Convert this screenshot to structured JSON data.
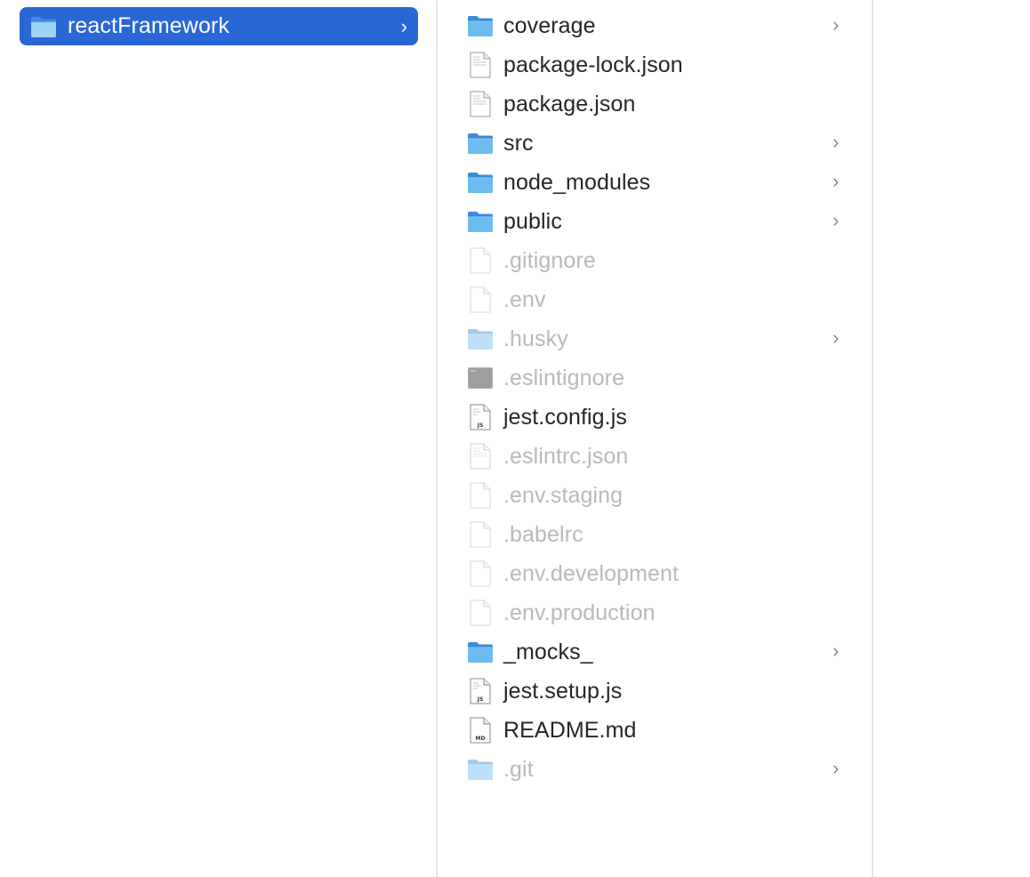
{
  "colors": {
    "selection": "#2966d6",
    "folder": "#5aaeea",
    "text": "#262626",
    "hidden_text": "#b9b9b9",
    "chevron": "#8a8a8a"
  },
  "column1": {
    "selected_folder": {
      "name": "reactFramework",
      "icon": "folder-icon",
      "chevron": "›"
    }
  },
  "column2": {
    "items": [
      {
        "name": "coverage",
        "kind": "folder",
        "icon": "folder-icon",
        "hidden": false,
        "chevron": "›"
      },
      {
        "name": "package-lock.json",
        "kind": "file",
        "icon": "document-icon",
        "hidden": false,
        "chevron": ""
      },
      {
        "name": "package.json",
        "kind": "file",
        "icon": "document-icon",
        "hidden": false,
        "chevron": ""
      },
      {
        "name": "src",
        "kind": "folder",
        "icon": "folder-icon",
        "hidden": false,
        "chevron": "›"
      },
      {
        "name": "node_modules",
        "kind": "folder",
        "icon": "folder-icon",
        "hidden": false,
        "chevron": "›"
      },
      {
        "name": "public",
        "kind": "folder",
        "icon": "folder-icon",
        "hidden": false,
        "chevron": "›"
      },
      {
        "name": ".gitignore",
        "kind": "file",
        "icon": "blank-file-icon",
        "hidden": true,
        "chevron": ""
      },
      {
        "name": ".env",
        "kind": "file",
        "icon": "blank-file-icon",
        "hidden": true,
        "chevron": ""
      },
      {
        "name": ".husky",
        "kind": "folder",
        "icon": "folder-icon",
        "hidden": true,
        "chevron": "›"
      },
      {
        "name": ".eslintignore",
        "kind": "file",
        "icon": "exec-file-icon",
        "hidden": true,
        "chevron": ""
      },
      {
        "name": "jest.config.js",
        "kind": "file",
        "icon": "js-file-icon",
        "hidden": false,
        "chevron": "",
        "badge": "JS"
      },
      {
        "name": ".eslintrc.json",
        "kind": "file",
        "icon": "document-icon",
        "hidden": true,
        "chevron": ""
      },
      {
        "name": ".env.staging",
        "kind": "file",
        "icon": "blank-file-icon",
        "hidden": true,
        "chevron": ""
      },
      {
        "name": ".babelrc",
        "kind": "file",
        "icon": "blank-file-icon",
        "hidden": true,
        "chevron": ""
      },
      {
        "name": ".env.development",
        "kind": "file",
        "icon": "blank-file-icon",
        "hidden": true,
        "chevron": ""
      },
      {
        "name": ".env.production",
        "kind": "file",
        "icon": "blank-file-icon",
        "hidden": true,
        "chevron": ""
      },
      {
        "name": "_mocks_",
        "kind": "folder",
        "icon": "folder-icon",
        "hidden": false,
        "chevron": "›"
      },
      {
        "name": "jest.setup.js",
        "kind": "file",
        "icon": "js-file-icon",
        "hidden": false,
        "chevron": "",
        "badge": "JS"
      },
      {
        "name": "README.md",
        "kind": "file",
        "icon": "md-file-icon",
        "hidden": false,
        "chevron": "",
        "badge": "MD"
      },
      {
        "name": ".git",
        "kind": "folder",
        "icon": "folder-icon",
        "hidden": true,
        "chevron": "›"
      }
    ]
  }
}
